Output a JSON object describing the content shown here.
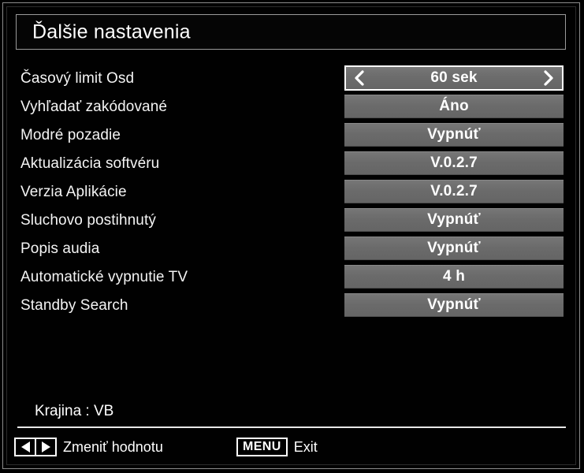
{
  "window": {
    "title": "Ďalšie nastavenia"
  },
  "settings": {
    "rows": [
      {
        "label": "Časový limit Osd",
        "value": "60 sek",
        "selected": true
      },
      {
        "label": "Vyhľadať zakódované",
        "value": "Áno",
        "selected": false
      },
      {
        "label": "Modré pozadie",
        "value": "Vypnúť",
        "selected": false
      },
      {
        "label": "Aktualizácia softvéru",
        "value": "V.0.2.7",
        "selected": false
      },
      {
        "label": "Verzia Aplikácie",
        "value": "V.0.2.7",
        "selected": false
      },
      {
        "label": "Sluchovo postihnutý",
        "value": "Vypnúť",
        "selected": false
      },
      {
        "label": "Popis audia",
        "value": "Vypnúť",
        "selected": false
      },
      {
        "label": "Automatické vypnutie TV",
        "value": "4 h",
        "selected": false
      },
      {
        "label": "Standby Search",
        "value": "Vypnúť",
        "selected": false
      }
    ]
  },
  "status": {
    "country_line": "Krajina : VB"
  },
  "footer": {
    "change_value_hint": "Zmeniť hodnotu",
    "menu_key_label": "MENU",
    "exit_hint": "Exit"
  },
  "icons": {
    "chevron_left": "chevron-left-icon",
    "chevron_right": "chevron-right-icon",
    "arrow_left": "arrow-left-icon",
    "arrow_right": "arrow-right-icon"
  },
  "colors": {
    "background": "#000000",
    "frame": "#8d8d8d",
    "value_box": "#6d6d6d",
    "text": "#ffffff",
    "highlight_border": "#ffffff"
  }
}
